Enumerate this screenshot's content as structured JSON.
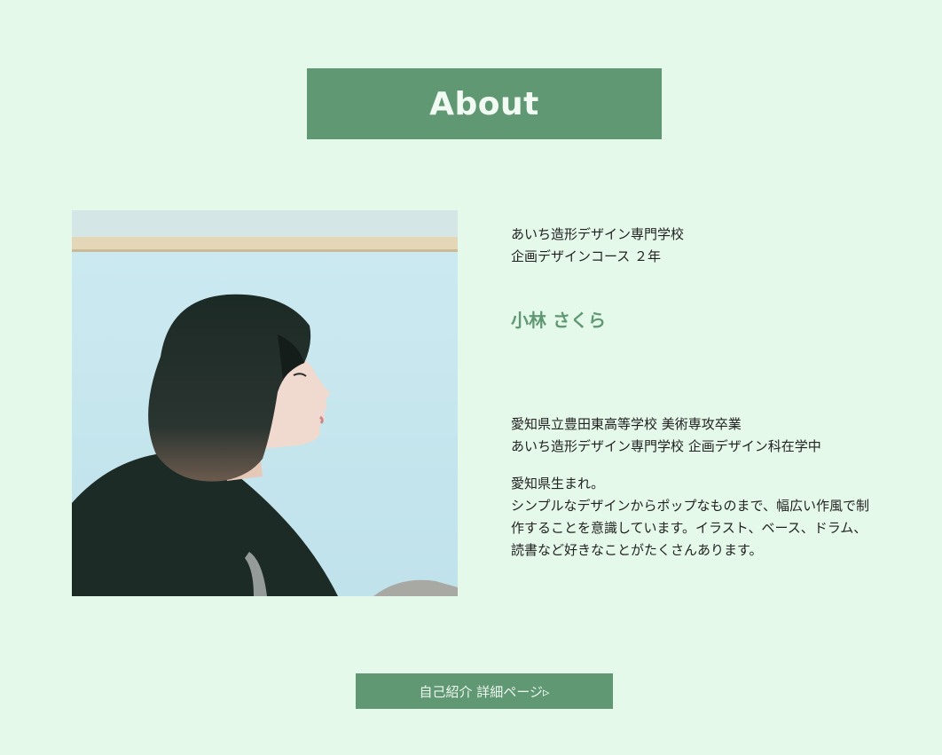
{
  "section": {
    "heading": "About"
  },
  "profile": {
    "school": "あいち造形デザイン専門学校",
    "course": "企画デザインコース ２年",
    "name": "小林 さくら",
    "education": [
      "愛知県立豊田東高等学校 美術専攻卒業",
      "あいち造形デザイン専門学校 企画デザイン科在学中"
    ],
    "bio": [
      "愛知県生まれ。",
      "シンプルなデザインからポップなものまで、幅広い作風で制",
      "作することを意識しています。イラスト、ベース、ドラム、",
      "読書など好きなことがたくさんあります。"
    ]
  },
  "button": {
    "label": "自己紹介 詳細ページ▹"
  },
  "colors": {
    "background": "#e5f9ea",
    "accent": "#5f9872"
  }
}
